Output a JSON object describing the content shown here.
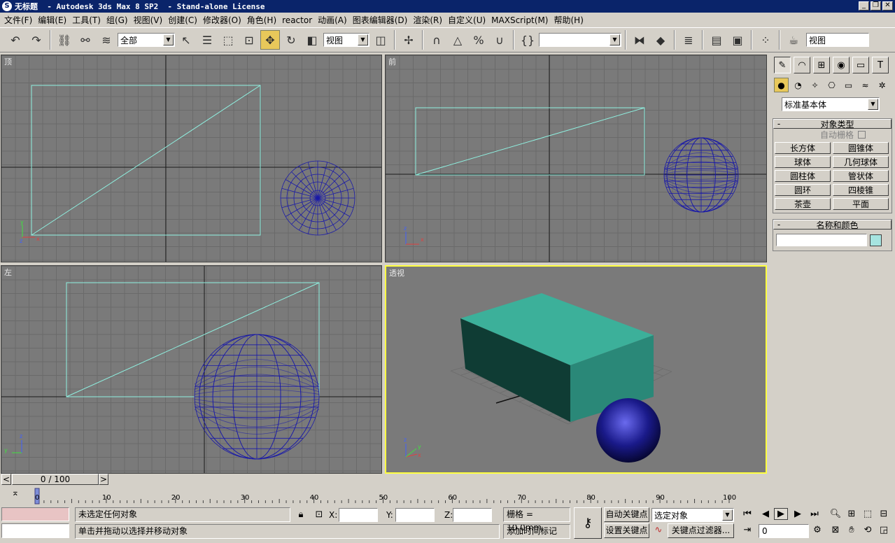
{
  "window": {
    "title": "无标题  - Autodesk 3ds Max 8 SP2  - Stand-alone License",
    "minimize": "_",
    "maximize": "❐",
    "close": "✕"
  },
  "menu": [
    "文件(F)",
    "编辑(E)",
    "工具(T)",
    "组(G)",
    "视图(V)",
    "创建(C)",
    "修改器(O)",
    "角色(H)",
    "reactor",
    "动画(A)",
    "图表编辑器(D)",
    "渲染(R)",
    "自定义(U)",
    "MAXScript(M)",
    "帮助(H)"
  ],
  "toolbar": {
    "selection_filter": "全部",
    "coord_system": "视图",
    "named_selection": "",
    "render_type": "视图"
  },
  "viewports": {
    "top": "顶",
    "front": "前",
    "left": "左",
    "perspective": "透视",
    "axis_x": "x",
    "axis_y": "y",
    "axis_z": "z"
  },
  "command_panel": {
    "category": "标准基本体",
    "object_type_title": "对象类型",
    "autogrid": "自动栅格",
    "objects": [
      "长方体",
      "圆锥体",
      "球体",
      "几何球体",
      "圆柱体",
      "管状体",
      "圆环",
      "四棱锥",
      "茶壶",
      "平面"
    ],
    "name_color_title": "名称和颜色",
    "object_name": "",
    "minus": "-",
    "object_color": "#a6e4e0"
  },
  "time_slider": {
    "frame_label": "0 / 100",
    "prev": "<",
    "next": ">"
  },
  "timeline": {
    "ticks": [
      "0",
      "10",
      "20",
      "30",
      "40",
      "50",
      "60",
      "70",
      "80",
      "90",
      "100"
    ]
  },
  "status": {
    "selection": "未选定任何对象",
    "prompt": "单击并拖动以选择并移动对象",
    "x_label": "X:",
    "y_label": "Y:",
    "z_label": "Z:",
    "x_value": "",
    "y_value": "",
    "z_value": "",
    "grid": "栅格 = 10.0mm",
    "add_time_tag": "添加时间标记",
    "auto_key": "自动关键点",
    "set_key": "设置关键点",
    "selected_object": "选定对象",
    "key_filters": "关键点过滤器...",
    "current_frame": "0"
  },
  "colors": {
    "title_bar": "#0a246a",
    "viewport_bg": "#7a7a7a",
    "active_viewport_border": "#ffff40",
    "box_wire": "#8ff0e0",
    "sphere_wire": "#1a1aa8",
    "box_shaded": "#3cb09a",
    "active_tool": "#e8c85a"
  },
  "icons": [
    "undo-icon",
    "redo-icon",
    "select-link-icon",
    "unlink-icon",
    "bind-space-warp-icon",
    "select-object-icon",
    "select-by-name-icon",
    "rect-region-icon",
    "window-crossing-icon",
    "move-icon",
    "rotate-icon",
    "scale-icon",
    "pivot-icon",
    "manipulate-icon",
    "snap-3d-icon",
    "angle-snap-icon",
    "percent-snap-icon",
    "spinner-snap-icon",
    "edit-named-sel-icon",
    "mirror-icon",
    "align-icon",
    "layer-icon",
    "curve-editor-icon",
    "schematic-icon",
    "material-editor-icon",
    "render-scene-icon"
  ]
}
